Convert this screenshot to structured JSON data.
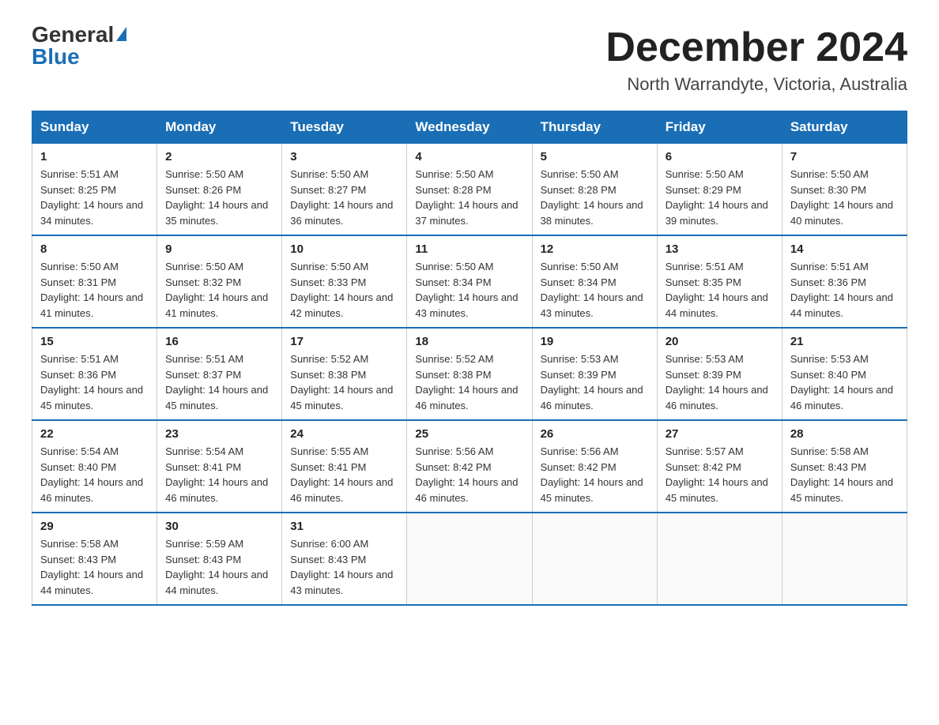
{
  "logo": {
    "general": "General",
    "blue": "Blue",
    "arrow": "▶"
  },
  "title": "December 2024",
  "subtitle": "North Warrandyte, Victoria, Australia",
  "days_of_week": [
    "Sunday",
    "Monday",
    "Tuesday",
    "Wednesday",
    "Thursday",
    "Friday",
    "Saturday"
  ],
  "weeks": [
    [
      {
        "day": "1",
        "sunrise": "5:51 AM",
        "sunset": "8:25 PM",
        "daylight": "14 hours and 34 minutes."
      },
      {
        "day": "2",
        "sunrise": "5:50 AM",
        "sunset": "8:26 PM",
        "daylight": "14 hours and 35 minutes."
      },
      {
        "day": "3",
        "sunrise": "5:50 AM",
        "sunset": "8:27 PM",
        "daylight": "14 hours and 36 minutes."
      },
      {
        "day": "4",
        "sunrise": "5:50 AM",
        "sunset": "8:28 PM",
        "daylight": "14 hours and 37 minutes."
      },
      {
        "day": "5",
        "sunrise": "5:50 AM",
        "sunset": "8:28 PM",
        "daylight": "14 hours and 38 minutes."
      },
      {
        "day": "6",
        "sunrise": "5:50 AM",
        "sunset": "8:29 PM",
        "daylight": "14 hours and 39 minutes."
      },
      {
        "day": "7",
        "sunrise": "5:50 AM",
        "sunset": "8:30 PM",
        "daylight": "14 hours and 40 minutes."
      }
    ],
    [
      {
        "day": "8",
        "sunrise": "5:50 AM",
        "sunset": "8:31 PM",
        "daylight": "14 hours and 41 minutes."
      },
      {
        "day": "9",
        "sunrise": "5:50 AM",
        "sunset": "8:32 PM",
        "daylight": "14 hours and 41 minutes."
      },
      {
        "day": "10",
        "sunrise": "5:50 AM",
        "sunset": "8:33 PM",
        "daylight": "14 hours and 42 minutes."
      },
      {
        "day": "11",
        "sunrise": "5:50 AM",
        "sunset": "8:34 PM",
        "daylight": "14 hours and 43 minutes."
      },
      {
        "day": "12",
        "sunrise": "5:50 AM",
        "sunset": "8:34 PM",
        "daylight": "14 hours and 43 minutes."
      },
      {
        "day": "13",
        "sunrise": "5:51 AM",
        "sunset": "8:35 PM",
        "daylight": "14 hours and 44 minutes."
      },
      {
        "day": "14",
        "sunrise": "5:51 AM",
        "sunset": "8:36 PM",
        "daylight": "14 hours and 44 minutes."
      }
    ],
    [
      {
        "day": "15",
        "sunrise": "5:51 AM",
        "sunset": "8:36 PM",
        "daylight": "14 hours and 45 minutes."
      },
      {
        "day": "16",
        "sunrise": "5:51 AM",
        "sunset": "8:37 PM",
        "daylight": "14 hours and 45 minutes."
      },
      {
        "day": "17",
        "sunrise": "5:52 AM",
        "sunset": "8:38 PM",
        "daylight": "14 hours and 45 minutes."
      },
      {
        "day": "18",
        "sunrise": "5:52 AM",
        "sunset": "8:38 PM",
        "daylight": "14 hours and 46 minutes."
      },
      {
        "day": "19",
        "sunrise": "5:53 AM",
        "sunset": "8:39 PM",
        "daylight": "14 hours and 46 minutes."
      },
      {
        "day": "20",
        "sunrise": "5:53 AM",
        "sunset": "8:39 PM",
        "daylight": "14 hours and 46 minutes."
      },
      {
        "day": "21",
        "sunrise": "5:53 AM",
        "sunset": "8:40 PM",
        "daylight": "14 hours and 46 minutes."
      }
    ],
    [
      {
        "day": "22",
        "sunrise": "5:54 AM",
        "sunset": "8:40 PM",
        "daylight": "14 hours and 46 minutes."
      },
      {
        "day": "23",
        "sunrise": "5:54 AM",
        "sunset": "8:41 PM",
        "daylight": "14 hours and 46 minutes."
      },
      {
        "day": "24",
        "sunrise": "5:55 AM",
        "sunset": "8:41 PM",
        "daylight": "14 hours and 46 minutes."
      },
      {
        "day": "25",
        "sunrise": "5:56 AM",
        "sunset": "8:42 PM",
        "daylight": "14 hours and 46 minutes."
      },
      {
        "day": "26",
        "sunrise": "5:56 AM",
        "sunset": "8:42 PM",
        "daylight": "14 hours and 45 minutes."
      },
      {
        "day": "27",
        "sunrise": "5:57 AM",
        "sunset": "8:42 PM",
        "daylight": "14 hours and 45 minutes."
      },
      {
        "day": "28",
        "sunrise": "5:58 AM",
        "sunset": "8:43 PM",
        "daylight": "14 hours and 45 minutes."
      }
    ],
    [
      {
        "day": "29",
        "sunrise": "5:58 AM",
        "sunset": "8:43 PM",
        "daylight": "14 hours and 44 minutes."
      },
      {
        "day": "30",
        "sunrise": "5:59 AM",
        "sunset": "8:43 PM",
        "daylight": "14 hours and 44 minutes."
      },
      {
        "day": "31",
        "sunrise": "6:00 AM",
        "sunset": "8:43 PM",
        "daylight": "14 hours and 43 minutes."
      },
      null,
      null,
      null,
      null
    ]
  ]
}
